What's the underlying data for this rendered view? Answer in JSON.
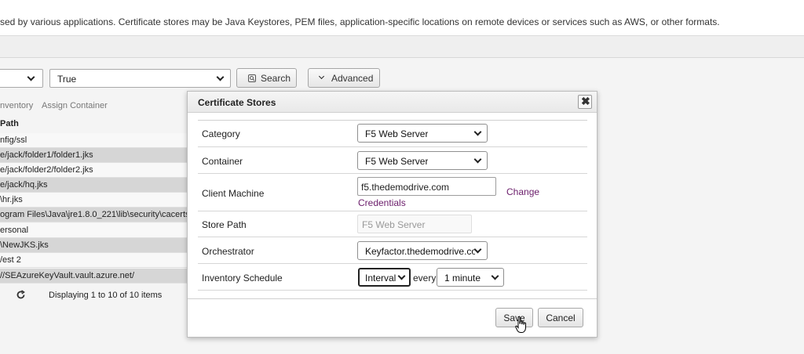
{
  "header": {
    "description": "sed by various applications. Certificate stores may be Java Keystores, PEM files, application-specific locations on remote devices or services such as AWS, or other formats."
  },
  "filters": {
    "first_select_value": "",
    "second_select_value": "True",
    "search_label": "Search",
    "advanced_label": "Advanced"
  },
  "grid": {
    "tabs": [
      "nventory",
      "Assign Container"
    ],
    "column_header": "Path",
    "rows": [
      "nfig/ssl",
      "e/jack/folder1/folder1.jks",
      "e/jack/folder2/folder2.jks",
      "e/jack/hq.jks",
      "\\hr.jks",
      "ogram Files\\Java\\jre1.8.0_221\\lib\\security\\cacerts",
      "ersonal",
      "\\NewJKS.jks",
      "/est 2",
      "//SEAzureKeyVault.vault.azure.net/"
    ],
    "pager_text": "Displaying 1 to 10 of 10 items"
  },
  "modal": {
    "title": "Certificate Stores",
    "fields": {
      "category": {
        "label": "Category",
        "value": "F5 Web Server"
      },
      "container": {
        "label": "Container",
        "value": "F5 Web Server"
      },
      "client_machine": {
        "label": "Client Machine",
        "value": "f5.thedemodrive.com",
        "link1": "Change",
        "link2": "Credentials"
      },
      "store_path": {
        "label": "Store Path",
        "placeholder": "F5 Web Server"
      },
      "orchestrator": {
        "label": "Orchestrator",
        "value": "Keyfactor.thedemodrive.cor"
      },
      "inventory_schedule": {
        "label": "Inventory Schedule",
        "interval_value": "Interval",
        "every_text": "every",
        "frequency_value": "1 minute"
      }
    },
    "save_label": "Save",
    "cancel_label": "Cancel"
  }
}
